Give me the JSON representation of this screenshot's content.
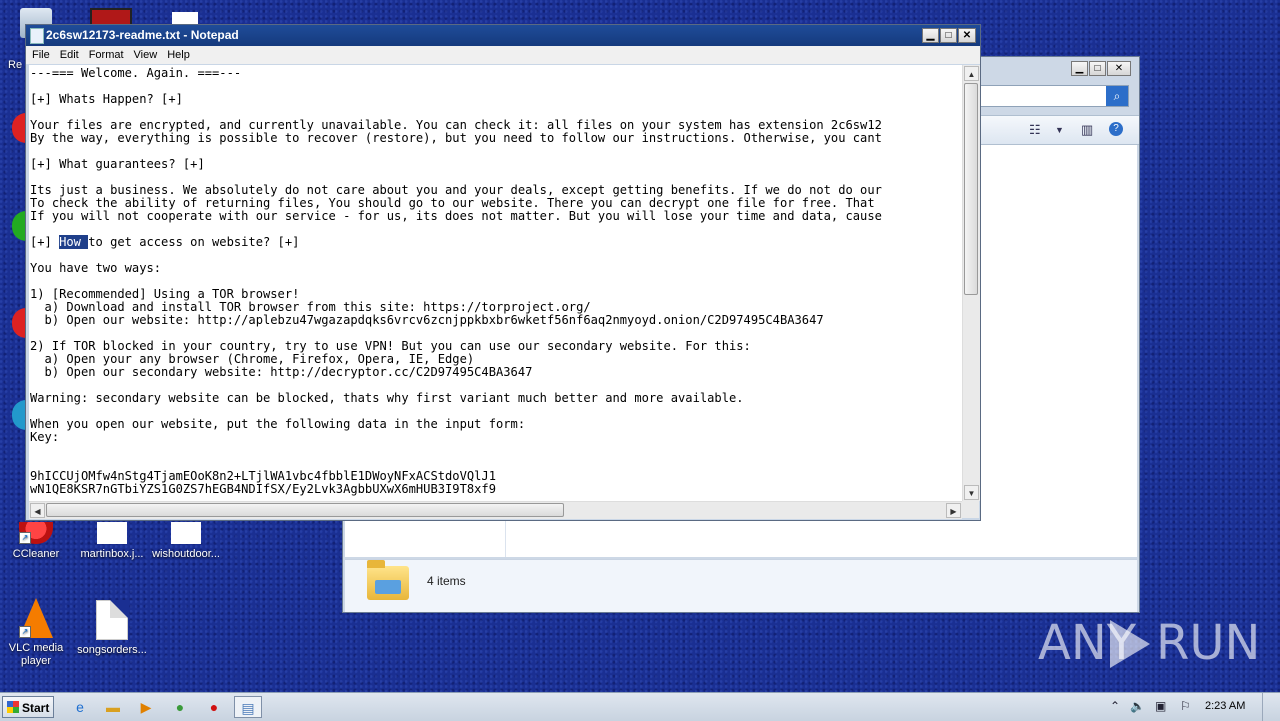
{
  "desktop": {
    "icons": [
      {
        "label": "CCleaner"
      },
      {
        "label": "martinbox.j..."
      },
      {
        "label": "wishoutdoor..."
      },
      {
        "label": "VLC media player"
      },
      {
        "label": "songsorders..."
      }
    ],
    "partial_label": "Re"
  },
  "explorer": {
    "minimize": "▁",
    "maximize": "□",
    "close": "✕",
    "item_count": "4 items"
  },
  "notepad": {
    "title": "2c6sw12173-readme.txt - Notepad",
    "menu": [
      "File",
      "Edit",
      "Format",
      "View",
      "Help"
    ],
    "text_before_selection": "---=== Welcome. Again. ===---\n\n[+] Whats Happen? [+]\n\nYour files are encrypted, and currently unavailable. You can check it: all files on your system has extension 2c6sw12\nBy the way, everything is possible to recover (restore), but you need to follow our instructions. Otherwise, you cant\n\n[+] What guarantees? [+]\n\nIts just a business. We absolutely do not care about you and your deals, except getting benefits. If we do not do our\nTo check the ability of returning files, You should go to our website. There you can decrypt one file for free. That\nIf you will not cooperate with our service - for us, its does not matter. But you will lose your time and data, cause\n\n[+] ",
    "selected_text": "How ",
    "text_after_selection": "to get access on website? [+]\n\nYou have two ways:\n\n1) [Recommended] Using a TOR browser!\n  a) Download and install TOR browser from this site: https://torproject.org/\n  b) Open our website: http://aplebzu47wgazapdqks6vrcv6zcnjppkbxbr6wketf56nf6aq2nmyoyd.onion/C2D97495C4BA3647\n\n2) If TOR blocked in your country, try to use VPN! But you can use our secondary website. For this:\n  a) Open your any browser (Chrome, Firefox, Opera, IE, Edge)\n  b) Open our secondary website: http://decryptor.cc/C2D97495C4BA3647\n\nWarning: secondary website can be blocked, thats why first variant much better and more available.\n\nWhen you open our website, put the following data in the input form:\nKey:\n\n\n9hICCUjOMfw4nStg4TjamEOoK8n2+LTjlWA1vbc4fbblE1DWoyNFxACStdoVQlJ1\nwN1QE8KSR7nGTbiYZS1G0ZS7hEGB4NDIfSX/Ey2Lvk3AgbbUXwX6mHUB3I9T8xf9",
    "minimize": "▁",
    "maximize": "□",
    "close": "✕"
  },
  "taskbar": {
    "start_label": "Start",
    "clock": "2:23 AM"
  },
  "watermark": {
    "left": "ANY",
    "right": "RUN"
  }
}
